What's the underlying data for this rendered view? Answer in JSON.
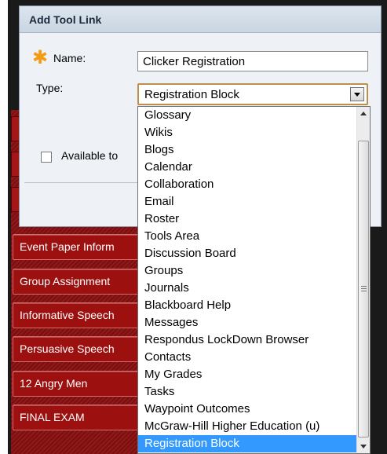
{
  "dialog": {
    "title": "Add Tool Link",
    "name_label": "Name:",
    "name_value": "Clicker Registration",
    "type_label": "Type:",
    "type_value": "Registration Block",
    "available_label": "Available to"
  },
  "course_menu": {
    "items": [
      "Event Paper Inform",
      "Group Assignment",
      "Informative Speech",
      "Persuasive Speech",
      "12 Angry Men",
      "FINAL EXAM"
    ]
  },
  "dropdown": {
    "options": [
      "Glossary",
      "Wikis",
      "Blogs",
      "Calendar",
      "Collaboration",
      "Email",
      "Roster",
      "Tools Area",
      "Discussion Board",
      "Groups",
      "Journals",
      "Blackboard Help",
      "Messages",
      "Respondus LockDown Browser",
      "Contacts",
      "My Grades",
      "Tasks",
      "Waypoint Outcomes",
      "McGraw-Hill Higher Education (u)",
      "Registration Block"
    ],
    "selected": "Registration Block"
  },
  "colors": {
    "menu_red": "#9c1010",
    "dialog_bg": "#eef2f6",
    "required_star": "#f39c12",
    "selection_blue": "#3399ff"
  },
  "icons": {
    "required": "asterisk-icon",
    "select_arrow": "chevron-down-icon",
    "scroll_up": "arrow-up-icon",
    "scroll_down": "arrow-down-icon"
  }
}
